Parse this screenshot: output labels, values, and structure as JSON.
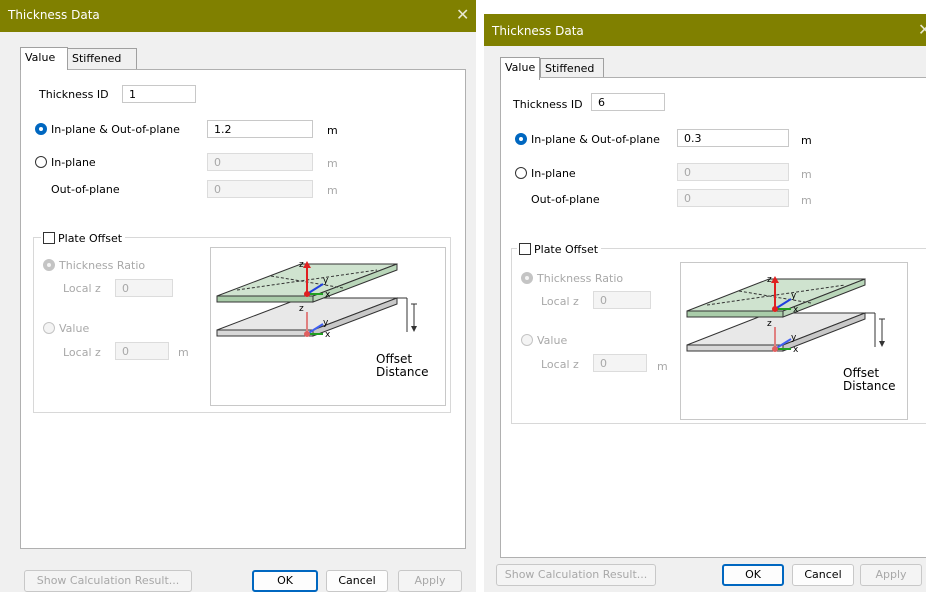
{
  "dialog_title": "Thickness Data",
  "close_glyph": "✕",
  "tabs": {
    "value": "Value",
    "stiffened": "Stiffened"
  },
  "labels": {
    "thickness_id": "Thickness ID",
    "in_out": "In-plane & Out-of-plane",
    "in_plane": "In-plane",
    "out_of_plane": "Out-of-plane",
    "unit_m": "m",
    "plate_offset": "Plate Offset",
    "thickness_ratio": "Thickness Ratio",
    "local_z": "Local z",
    "value_option": "Value",
    "offset_distance": "Offset\nDistance",
    "axis_z": "z",
    "axis_y": "y",
    "axis_x": "x"
  },
  "buttons": {
    "show_calc": "Show Calculation Result...",
    "ok": "OK",
    "cancel": "Cancel",
    "apply": "Apply"
  },
  "dialogs": [
    {
      "thickness_id": "1",
      "in_out_value": "1.2",
      "in_plane_value": "0",
      "out_plane_value": "0",
      "ratio_local_z": "0",
      "value_local_z": "0"
    },
    {
      "thickness_id": "6",
      "in_out_value": "0.3",
      "in_plane_value": "0",
      "out_plane_value": "0",
      "ratio_local_z": "0",
      "value_local_z": "0"
    }
  ]
}
